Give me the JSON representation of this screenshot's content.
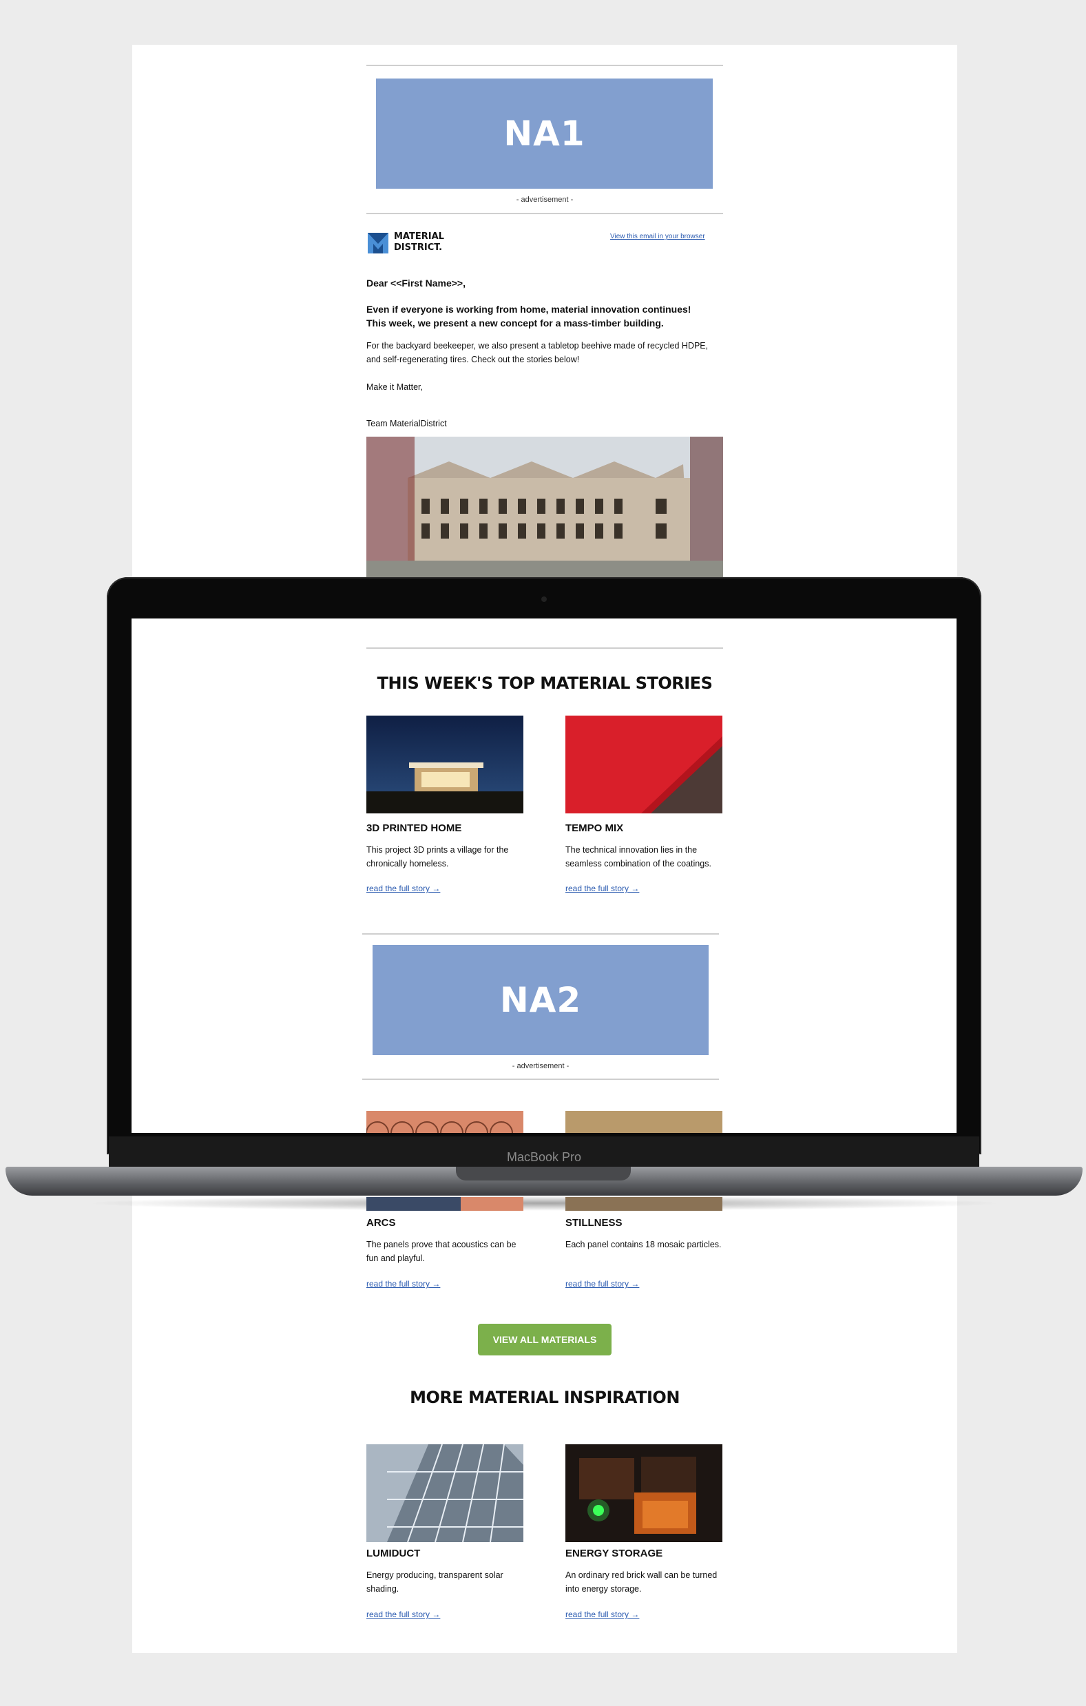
{
  "ads": {
    "na1_label": "NA1",
    "na2_label": "NA2",
    "note": "- advertisement -"
  },
  "header": {
    "logo_line1": "MATERIAL",
    "logo_line2": "DISTRICT.",
    "view_in_browser": "View this email in your browser"
  },
  "intro": {
    "greeting": "Dear <<First Name>>,",
    "headline_1": "Even if everyone is working from home, material innovation continues!",
    "headline_2": "This week, we present a new concept for a mass-timber building.",
    "body": "For the backyard beekeeper, we also present a tabletop beehive made of recycled HDPE, and self-regenerating tires. Check out the stories below!",
    "signoff": "Make it Matter,",
    "team": "Team MaterialDistrict"
  },
  "sections": {
    "top_stories_title": "THIS WEEK'S TOP MATERIAL STORIES",
    "inspiration_title": "MORE MATERIAL INSPIRATION"
  },
  "stories": [
    {
      "title": "3D PRINTED HOME",
      "desc": "This project 3D prints a village for the chronically homeless.",
      "link": "read the full story →"
    },
    {
      "title": "TEMPO MIX",
      "desc": "The technical innovation lies in the seamless combination of the coatings.",
      "link": "read the full story →"
    },
    {
      "title": "ARCS",
      "desc": "The panels prove that acoustics can be fun and playful.",
      "link": "read the full story →"
    },
    {
      "title": "STILLNESS",
      "desc": "Each panel contains 18 mosaic particles.",
      "link": "read the full story →"
    },
    {
      "title": "LUMIDUCT",
      "desc": "Energy producing, transparent solar shading.",
      "link": "read the full story →"
    },
    {
      "title": "ENERGY STORAGE",
      "desc": "An ordinary red brick wall can be turned into energy storage.",
      "link": "read the full story →"
    }
  ],
  "cta": {
    "label": "VIEW ALL MATERIALS"
  },
  "laptop": {
    "brand": "MacBook Pro"
  },
  "colors": {
    "ad_blue": "#829fcf",
    "cta_green": "#7cb04b",
    "link_blue": "#2b5bb0"
  }
}
